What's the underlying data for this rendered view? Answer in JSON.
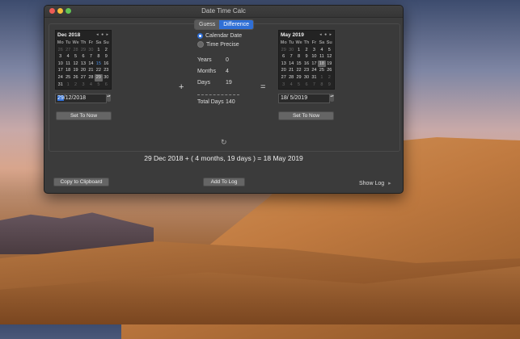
{
  "window": {
    "title": "Date Time Calc"
  },
  "tabs": [
    {
      "label": "Guess"
    },
    {
      "label": "Difference"
    }
  ],
  "left_calendar": {
    "month_label": "Dec 2018",
    "nav": "◂ ● ▸",
    "weekdays": [
      "Mo",
      "Tu",
      "We",
      "Th",
      "Fr",
      "Sa",
      "Su"
    ],
    "days": [
      [
        "26",
        "27",
        "28",
        "29",
        "30",
        "1",
        "2"
      ],
      [
        "3",
        "4",
        "5",
        "6",
        "7",
        "8",
        "9"
      ],
      [
        "10",
        "11",
        "12",
        "13",
        "14",
        "15",
        "16"
      ],
      [
        "17",
        "18",
        "19",
        "20",
        "21",
        "22",
        "23"
      ],
      [
        "24",
        "25",
        "26",
        "27",
        "28",
        "29",
        "30"
      ],
      [
        "31",
        "1",
        "2",
        "3",
        "4",
        "5",
        "6"
      ]
    ],
    "date_field": {
      "day": "29",
      "rest": "/12/2018"
    },
    "set_now": "Set To Now"
  },
  "right_calendar": {
    "month_label": "May 2019",
    "nav": "◂ ● ▸",
    "weekdays": [
      "Mo",
      "Tu",
      "We",
      "Th",
      "Fr",
      "Sa",
      "Su"
    ],
    "days": [
      [
        "29",
        "30",
        "1",
        "2",
        "3",
        "4",
        "5"
      ],
      [
        "6",
        "7",
        "8",
        "9",
        "10",
        "11",
        "12"
      ],
      [
        "13",
        "14",
        "15",
        "16",
        "17",
        "18",
        "19"
      ],
      [
        "20",
        "21",
        "22",
        "23",
        "24",
        "25",
        "26"
      ],
      [
        "27",
        "28",
        "29",
        "30",
        "31",
        "1",
        "2"
      ],
      [
        "3",
        "4",
        "5",
        "6",
        "7",
        "8",
        "9"
      ]
    ],
    "date_field": "18/  5/2019",
    "set_now": "Set To Now"
  },
  "operators": {
    "plus": "+",
    "equals": "="
  },
  "mode": {
    "calendar_date": "Calendar Date",
    "time_precise": "Time Precise"
  },
  "difference": {
    "years_label": "Years",
    "years": "0",
    "months_label": "Months",
    "months": "4",
    "days_label": "Days",
    "days": "19",
    "total_label": "Total Days",
    "total": "140"
  },
  "result": "29 Dec 2018 + ( 4 months, 19 days ) = 18 May 2019",
  "footer": {
    "copy": "Copy to Clipboard",
    "add_log": "Add To Log",
    "show_log": "Show Log",
    "show_log_arrow": "▸"
  },
  "stepper": "▴▾",
  "spinner": "↻"
}
